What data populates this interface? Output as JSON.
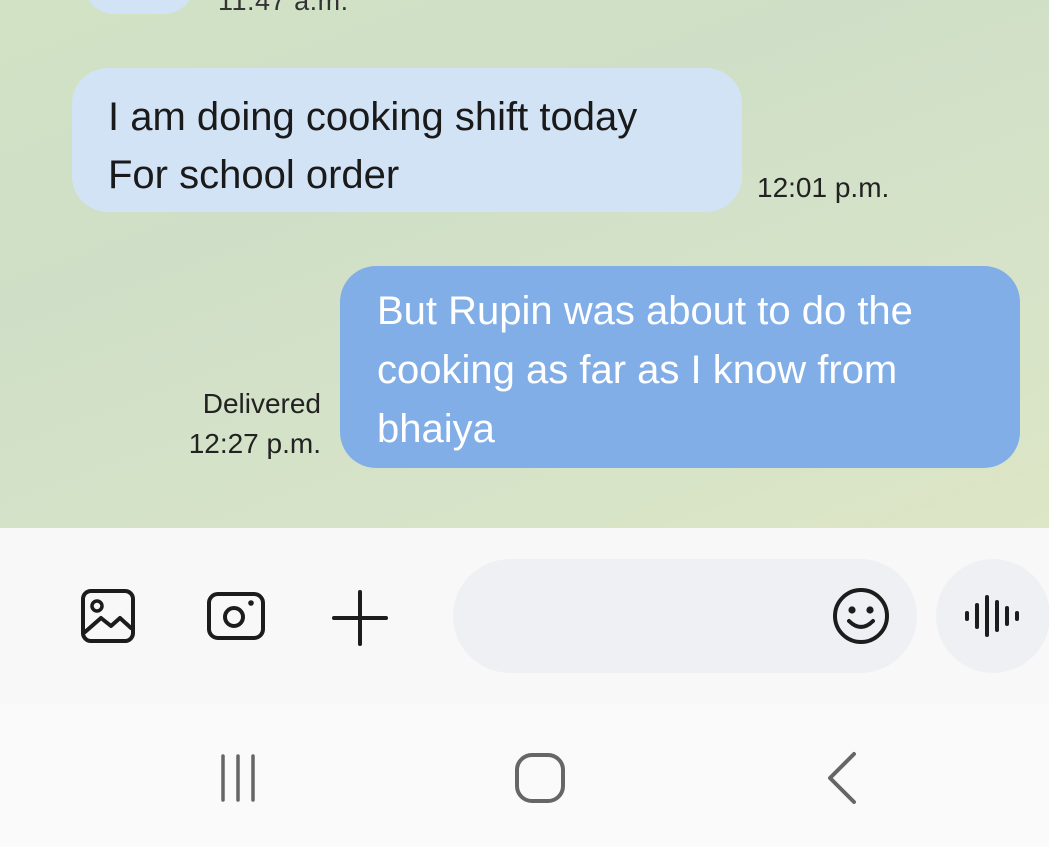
{
  "conversation": {
    "previous_time_partial": "11:47 a.m.",
    "incoming": {
      "lines": [
        "I am doing cooking shift today",
        "For school order"
      ],
      "time": "12:01 p.m."
    },
    "outgoing": {
      "lines": [
        "But Rupin was about to do the",
        "cooking as far as I know from",
        "bhaiya"
      ],
      "status": "Delivered",
      "time": "12:27 p.m."
    }
  },
  "composer": {
    "gallery_icon": "gallery-icon",
    "camera_icon": "camera-icon",
    "plus_icon": "plus-icon",
    "message_placeholder": "",
    "emoji_icon": "smiley-icon",
    "voice_icon": "voice-waveform-icon"
  },
  "navigation": {
    "recents_icon": "recents-icon",
    "home_icon": "home-icon",
    "back_icon": "back-icon"
  },
  "colors": {
    "incoming_bubble": "#d3e3f6",
    "outgoing_bubble": "#82aee8",
    "chat_background": "#d2e2c4"
  }
}
